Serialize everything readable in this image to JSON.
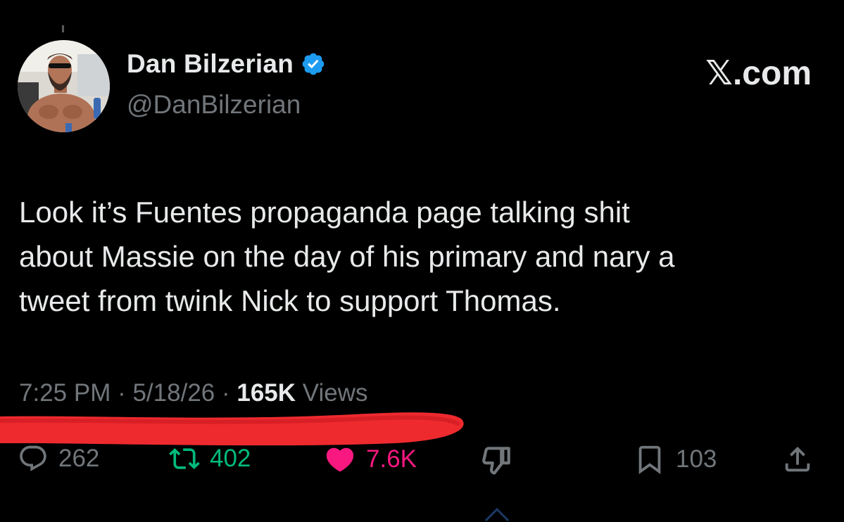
{
  "author": {
    "display_name": "Dan Bilzerian",
    "handle": "@DanBilzerian",
    "verified": true
  },
  "watermark": {
    "x_letter": "𝕏",
    "domain_suffix": ".com"
  },
  "tweet": {
    "text": "Look it’s Fuentes propaganda page talking shit\nabout Massie on the day of his primary and nary a\ntweet from twink Nick to support Thomas."
  },
  "meta": {
    "time": "7:25 PM",
    "separator": " · ",
    "date": "5/18/26",
    "views_count": "165K",
    "views_label": "Views"
  },
  "actions": {
    "reply_count": "262",
    "retweet_count": "402",
    "like_count": "7.6K",
    "bookmark_count": "103"
  },
  "icons": {
    "reply": "reply-icon",
    "retweet": "retweet-icon",
    "like": "heart-icon",
    "dislike": "thumbs-down-icon",
    "bookmark": "bookmark-icon",
    "share": "share-icon",
    "verified": "verified-badge-icon"
  },
  "colors": {
    "background": "#000000",
    "text_primary": "#e7e9ea",
    "text_secondary": "#71767b",
    "verified_blue": "#1d9bf0",
    "retweet_green": "#00ba7c",
    "like_pink": "#f91880",
    "scribble_red": "#ee2a2f"
  }
}
